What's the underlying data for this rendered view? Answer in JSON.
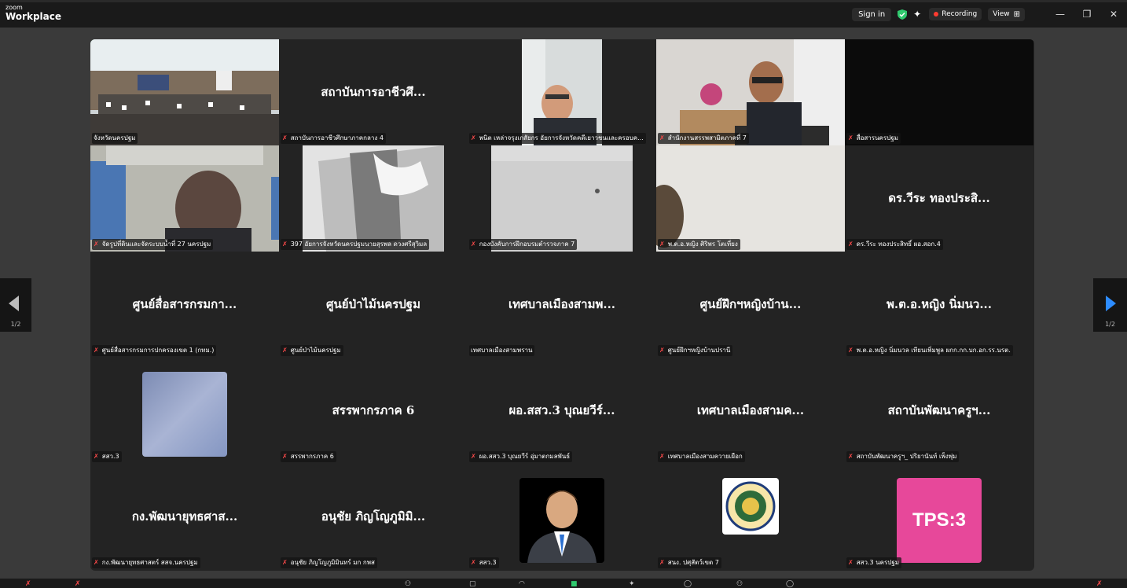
{
  "app": {
    "logo_small": "zoom",
    "logo_big": "Workplace"
  },
  "topbar": {
    "signin_label": "Sign in",
    "recording_label": "Recording",
    "view_label": "View",
    "grid_icon": "⊞",
    "minimize": "—",
    "restore": "❐",
    "close": "✕"
  },
  "pagination": {
    "left": "1/2",
    "right": "1/2"
  },
  "colors": {
    "accent": "#2d8cff",
    "active_speaker": "#30c96e",
    "muted": "#ff4a4a",
    "recording": "#ff3b30"
  },
  "participants": [
    {
      "label": "จังหวัดนครปฐม",
      "big": "",
      "kind": "video-room",
      "muted": false
    },
    {
      "label": "สถาบันการอาชีวศึกษาภาคกลาง 4",
      "big": "สถาบันการอาชีวศึ...",
      "kind": "name",
      "muted": true
    },
    {
      "label": "พนิต เหล่าจรุงเกสัยกร อัยการจังหวัดคดีเยาวชนและครอบค...",
      "big": "",
      "kind": "video-man",
      "muted": true
    },
    {
      "label": "สำนักงานสรรพสามิตภาคที่ 7",
      "big": "",
      "kind": "video-office",
      "muted": true
    },
    {
      "label": "สื่อสารนครปฐม",
      "big": "",
      "kind": "video-dark",
      "muted": true
    },
    {
      "label": "จัดรูปที่ดินและจัดระบบน้ำที่ 27 นครปฐม",
      "big": "",
      "kind": "video-man2",
      "muted": true
    },
    {
      "label": "397 อัยการจังหวัดนครปฐมนายสุรพล ดวงศรีสุวิมล",
      "big": "",
      "kind": "video-ceiling",
      "muted": true
    },
    {
      "label": "กองบังคับการฝึกอบรมตำรวจภาค 7",
      "big": "",
      "kind": "video-wall",
      "muted": true
    },
    {
      "label": "พ.ต.อ.หญิง ศิริพร โตเที่ยง",
      "big": "",
      "kind": "video-light",
      "muted": true
    },
    {
      "label": "ดร.วีระ ทองประสิทธิ์ ผอ.สอก.4",
      "big": "ดร.วีระ ทองประสิ...",
      "kind": "name",
      "muted": true
    },
    {
      "label": "ศูนย์สื่อสารกรมการปกครองเขต 1 (กทม.)",
      "big": "ศูนย์สื่อสารกรมกา...",
      "kind": "name",
      "muted": true
    },
    {
      "label": "ศูนย์ป่าไม้นครปฐม",
      "big": "ศูนย์ป่าไม้นครปฐม",
      "kind": "name",
      "muted": true
    },
    {
      "label": "เทศบาลเมืองสามพราน",
      "big": "เทศบาลเมืองสามพ...",
      "kind": "name",
      "muted": false
    },
    {
      "label": "ศูนย์ฝึกฯหญิงบ้านปรานี",
      "big": "ศูนย์ฝึกฯหญิงบ้าน...",
      "kind": "name",
      "muted": true
    },
    {
      "label": "พ.ต.อ.หญิง นิ่มนวล เทียนเพิ่มพูล ผกก.กก.บก.อก.รร.นรต.",
      "big": "พ.ต.อ.หญิง นิ่มนว...",
      "kind": "name",
      "muted": true
    },
    {
      "label": "สสว.3",
      "big": "",
      "kind": "avatar-blur",
      "muted": true
    },
    {
      "label": "สรรพากรภาค 6",
      "big": "สรรพากรภาค 6",
      "kind": "name",
      "muted": true
    },
    {
      "label": "ผอ.สสว.3 บุณยวีร์ อุ่มาตกมลพันธ์",
      "big": "ผอ.สสว.3 บุณยวีร์...",
      "kind": "name",
      "muted": true
    },
    {
      "label": "เทศบาลเมืองสามควายเผือก",
      "big": "เทศบาลเมืองสามค...",
      "kind": "name",
      "muted": true
    },
    {
      "label": "สถาบันพัฒนาครูฯ_ ปริยานันท์ เพ็งพุ่ม",
      "big": "สถาบันพัฒนาครูฯ...",
      "kind": "name",
      "muted": true
    },
    {
      "label": "กง.พัฒนายุทธศาสตร์ สสจ.นครปฐม",
      "big": "กง.พัฒนายุทธศาส...",
      "kind": "name",
      "muted": true
    },
    {
      "label": "อนุชัย ภิญโญภูมิมินทร์ มก กพส",
      "big": "อนุชัย ภิญโญภูมิมิ...",
      "kind": "name",
      "muted": true
    },
    {
      "label": "สสว.3",
      "big": "",
      "kind": "avatar-person",
      "muted": true
    },
    {
      "label": "สนง. ปศุสัตว์เขต 7",
      "big": "",
      "kind": "avatar-seal",
      "muted": true
    },
    {
      "label": "สสว.3 นครปฐม",
      "big": "",
      "kind": "avatar-tps",
      "muted": true
    }
  ],
  "tps_logo_text": "TPS:3"
}
